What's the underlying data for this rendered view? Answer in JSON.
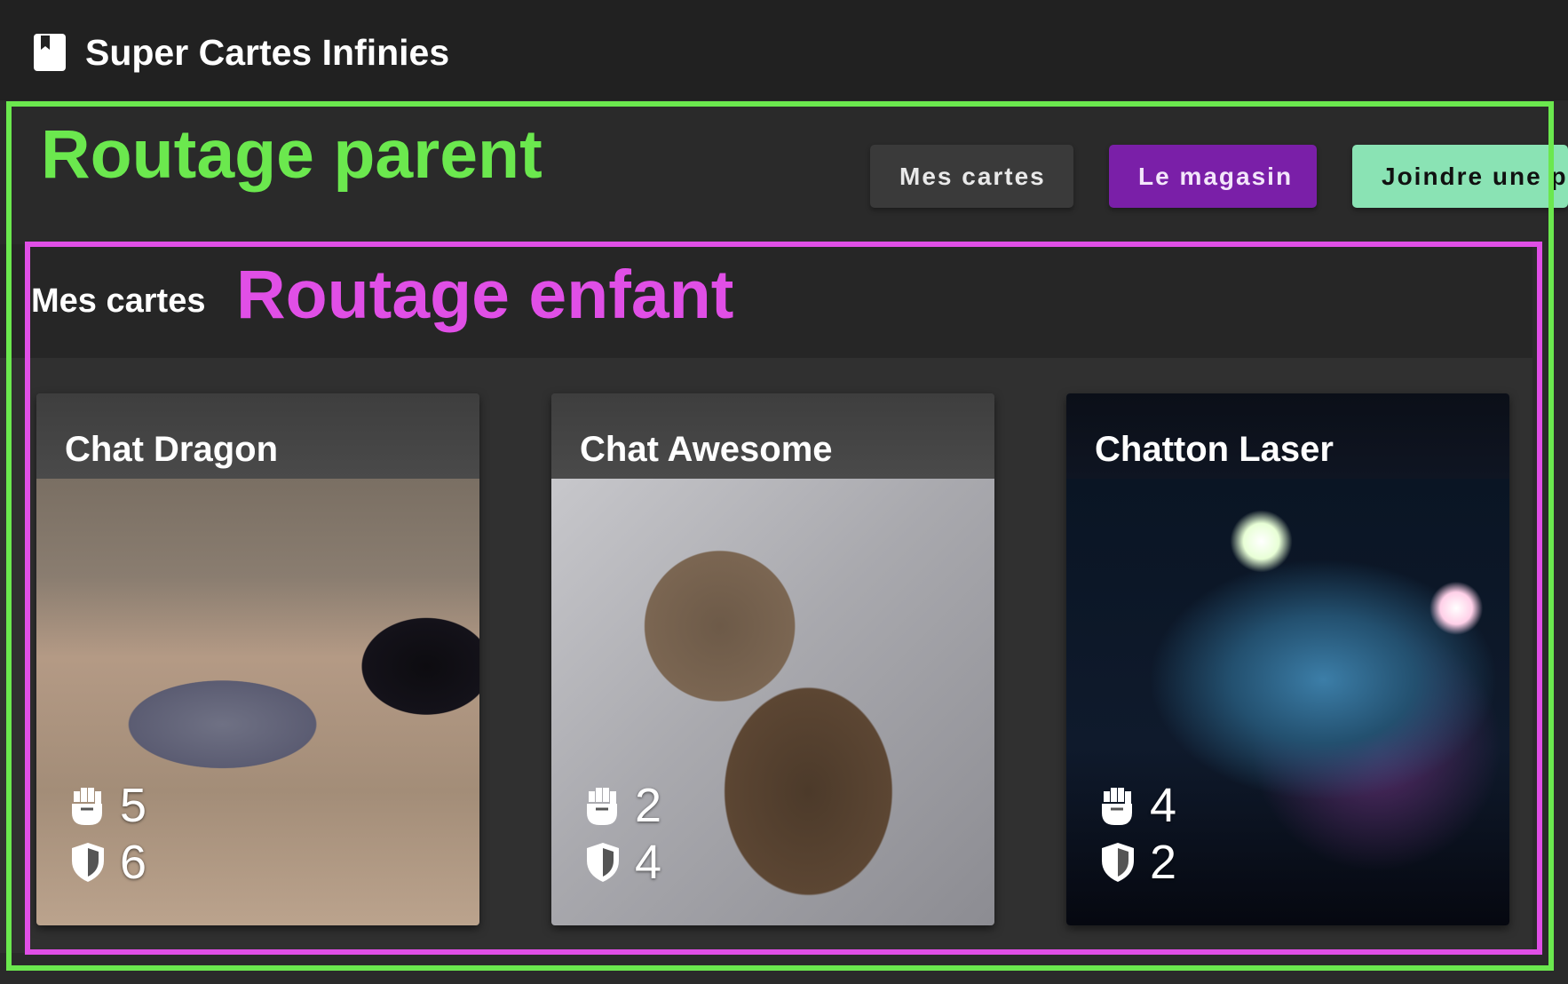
{
  "app": {
    "title": "Super Cartes Infinies",
    "icon": "book-icon"
  },
  "annotations": {
    "parent_label": "Routage parent",
    "parent_color": "#6be84e",
    "child_label": "Routage enfant",
    "child_color": "#e04fe6"
  },
  "nav": {
    "buttons": [
      {
        "label": "Mes cartes",
        "color": "#3a3a3a"
      },
      {
        "label": "Le magasin",
        "color": "#7a1fa8"
      },
      {
        "label": "Joindre une partie",
        "color": "#8ae3b4"
      }
    ]
  },
  "child": {
    "title": "Mes cartes"
  },
  "cards": [
    {
      "name": "Chat Dragon",
      "attack": "5",
      "defense": "6",
      "attack_icon": "fist-icon",
      "defense_icon": "shield-icon"
    },
    {
      "name": "Chat Awesome",
      "attack": "2",
      "defense": "4",
      "attack_icon": "fist-icon",
      "defense_icon": "shield-icon"
    },
    {
      "name": "Chatton Laser",
      "attack": "4",
      "defense": "2",
      "attack_icon": "fist-icon",
      "defense_icon": "shield-icon"
    }
  ]
}
